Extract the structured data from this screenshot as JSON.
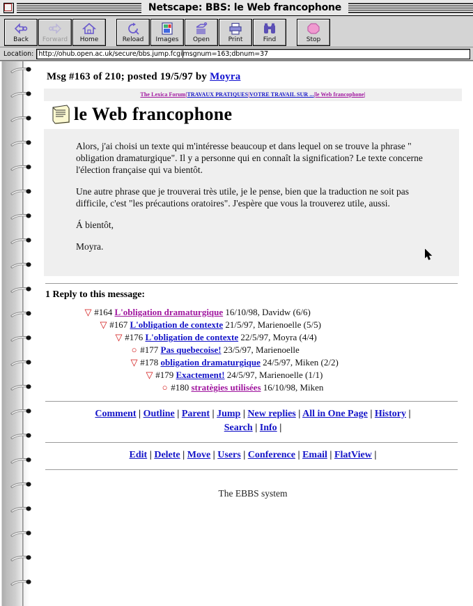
{
  "window": {
    "title": "Netscape: BBS: le Web francophone",
    "close_label": "close-box"
  },
  "toolbar": {
    "buttons": [
      {
        "label": "Back",
        "icon": "back-arrow-icon",
        "disabled": false
      },
      {
        "label": "Forward",
        "icon": "forward-arrow-icon",
        "disabled": true
      },
      {
        "label": "Home",
        "icon": "house-icon",
        "disabled": false
      },
      {
        "label": "Reload",
        "icon": "reload-icon",
        "disabled": false
      },
      {
        "label": "Images",
        "icon": "images-icon",
        "disabled": false
      },
      {
        "label": "Open",
        "icon": "open-icon",
        "disabled": false
      },
      {
        "label": "Print",
        "icon": "printer-icon",
        "disabled": false
      },
      {
        "label": "Find",
        "icon": "binoculars-icon",
        "disabled": false
      },
      {
        "label": "Stop",
        "icon": "stop-sign-icon",
        "disabled": false
      }
    ]
  },
  "location": {
    "label": "Location:",
    "url_before_caret": "http://ohub.open.ac.uk/secure/bbs.jump.fcgi",
    "url_after_caret": "msgnum=163;dbnum=37",
    "full_url": "http://ohub.open.ac.uk/secure/bbs.jump.fcgi?msgnum=163;dbnum=37"
  },
  "message": {
    "header_prefix": "Msg #163 of 210; posted 19/5/97 by ",
    "author": "Moyra",
    "breadcrumb": [
      {
        "label": "The Lexica Forum",
        "visited": true
      },
      {
        "label": "TRAVAUX PRATIQUES",
        "visited": false
      },
      {
        "label": "VOTRE TRAVAIL SUR ...",
        "visited": false
      },
      {
        "label": "le Web francophone",
        "visited": true
      }
    ],
    "breadcrumb_separator": "|",
    "title": "le Web francophone",
    "title_icon": "notepad-icon",
    "paragraphs": [
      "Alors, j'ai choisi un texte qui m'intéresse beaucoup et dans lequel on se trouve la phrase \" obligation dramaturgique\". Il y a personne qui en connaît la signification? Le texte concerne l'élection française qui va bientôt.",
      "Une autre phrase que je trouverai très utile, je le pense, bien que la traduction ne soit pas difficile, c'est \"les précautions oratoires\". J'espère que vous la trouverez utile, aussi.",
      "Á bientôt,",
      "Moyra."
    ]
  },
  "replies": {
    "heading": "1 Reply to this message:",
    "items": [
      {
        "marker": "▽",
        "indent": 0,
        "num": "#164",
        "title": "L'obligation dramaturgique",
        "visited": true,
        "date": "16/10/98",
        "author": "Davidw",
        "count": "(6/6)"
      },
      {
        "marker": "▽",
        "indent": 1,
        "num": "#167",
        "title": "L'obligation de contexte",
        "visited": false,
        "date": "21/5/97",
        "author": "Marienoelle",
        "count": "(5/5)"
      },
      {
        "marker": "▽",
        "indent": 2,
        "num": "#176",
        "title": "L'obligation de contexte",
        "visited": false,
        "date": "22/5/97",
        "author": "Moyra",
        "count": "(4/4)"
      },
      {
        "marker": "○",
        "indent": 3,
        "num": "#177",
        "title": "Pas quebecoise!",
        "visited": false,
        "date": "23/5/97",
        "author": "Marienoelle",
        "count": ""
      },
      {
        "marker": "▽",
        "indent": 3,
        "num": "#178",
        "title": "obligation dramaturgique",
        "visited": false,
        "date": "24/5/97",
        "author": "Miken",
        "count": "(2/2)"
      },
      {
        "marker": "▽",
        "indent": 4,
        "num": "#179",
        "title": "Exactement!",
        "visited": false,
        "date": "24/5/97",
        "author": "Marienoelle",
        "count": "(1/1)"
      },
      {
        "marker": "○",
        "indent": 5,
        "num": "#180",
        "title": "stratègies utilisées",
        "visited": true,
        "date": "16/10/98",
        "author": "Miken",
        "count": ""
      }
    ]
  },
  "nav_primary": {
    "row1": [
      "Comment",
      "Outline",
      "Parent",
      "Jump",
      "New replies",
      "All in One Page",
      "History"
    ],
    "row2": [
      "Search",
      "Info"
    ],
    "separator": "|"
  },
  "nav_secondary": {
    "items": [
      "Edit",
      "Delete",
      "Move",
      "Users",
      "Conference",
      "Email",
      "FlatView"
    ],
    "separator": "|"
  },
  "footer": {
    "text": "The EBBS system"
  },
  "colors": {
    "link": "#1414c8",
    "visited": "#a0169f",
    "marker": "#d01010",
    "body_bg": "#efefef",
    "chrome": "#d4d4d4"
  }
}
